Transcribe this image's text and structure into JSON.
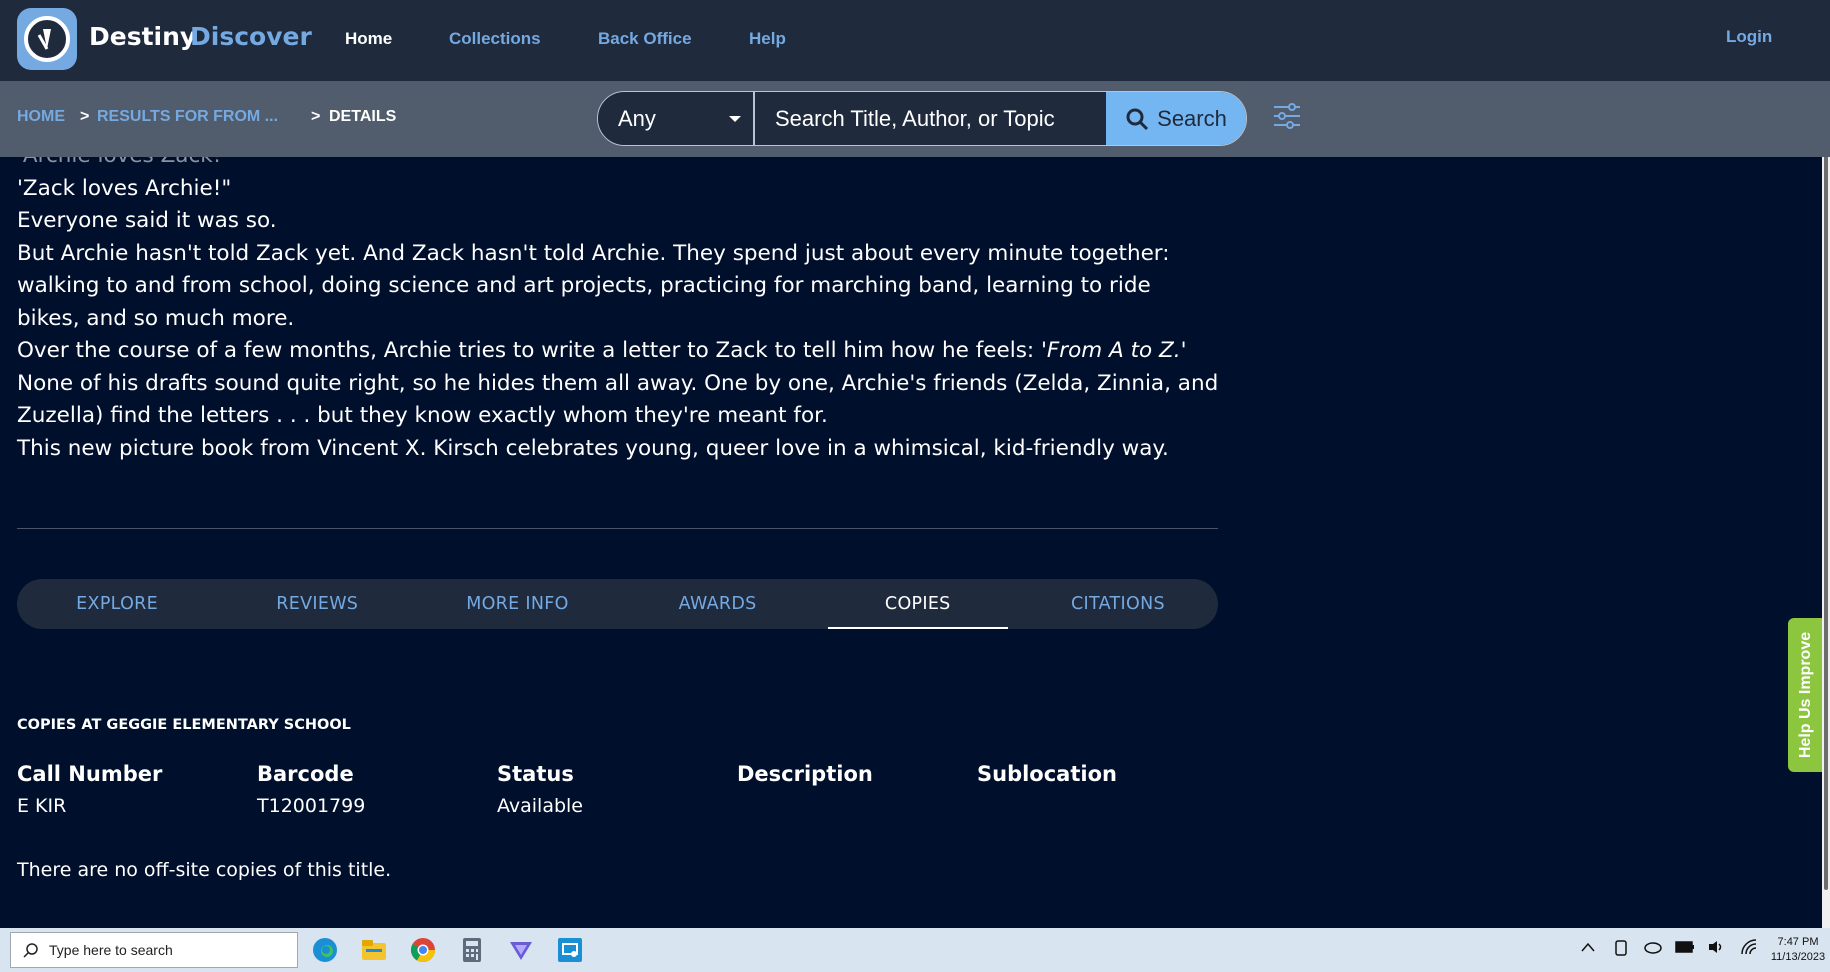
{
  "brand": {
    "part1": "Destiny",
    "part2": "Discover"
  },
  "nav": {
    "home": "Home",
    "collections": "Collections",
    "back_office": "Back Office",
    "help": "Help",
    "login": "Login"
  },
  "breadcrumb": {
    "home": "HOME",
    "sep": ">",
    "results": "RESULTS FOR FROM ...",
    "details": "DETAILS"
  },
  "search": {
    "scope": "Any",
    "placeholder": "Search Title, Author, or Topic",
    "button": "Search"
  },
  "description": {
    "faded_line": "'Archie loves Zack!'",
    "lines": [
      "'Zack loves Archie!\"",
      "Everyone said it was so.",
      "But Archie hasn't told Zack yet. And Zack hasn't told Archie. They spend just about every minute together:",
      "walking to and from school, doing science and art projects, practicing for marching band, learning to ride",
      "bikes, and so much more."
    ],
    "line_with_italic_pre": "Over the course of a few months, Archie tries to write a letter to Zack to tell him how he feels: '",
    "line_with_italic_em": "From A to Z.",
    "line_with_italic_post": "'",
    "lines_after": [
      "None of his drafts sound quite right, so he hides them all away. One by one, Archie's friends (Zelda, Zinnia, and",
      "Zuzella) find the letters . . . but they know exactly whom they're meant for.",
      "This new picture book from Vincent X. Kirsch celebrates young, queer love in a whimsical, kid-friendly way."
    ]
  },
  "tabs": [
    "EXPLORE",
    "REVIEWS",
    "MORE INFO",
    "AWARDS",
    "COPIES",
    "CITATIONS"
  ],
  "active_tab": "COPIES",
  "copies": {
    "heading": "COPIES AT GEGGIE ELEMENTARY SCHOOL",
    "columns": [
      "Call Number",
      "Barcode",
      "Status",
      "Description",
      "Sublocation"
    ],
    "row": {
      "call_number": "E KIR",
      "barcode": "T12001799",
      "status": "Available",
      "description": "",
      "sublocation": ""
    },
    "offsite_note": "There are no off-site copies of this title."
  },
  "feedback": {
    "label": "Help Us Improve"
  },
  "taskbar": {
    "search_placeholder": "Type here to search",
    "time": "7:47 PM",
    "date": "11/13/2023"
  },
  "colors": {
    "accent": "#74a9e2",
    "page_bg": "#000f2b",
    "nav_bg": "#1f2a3d",
    "feedback": "#8cc63f"
  }
}
